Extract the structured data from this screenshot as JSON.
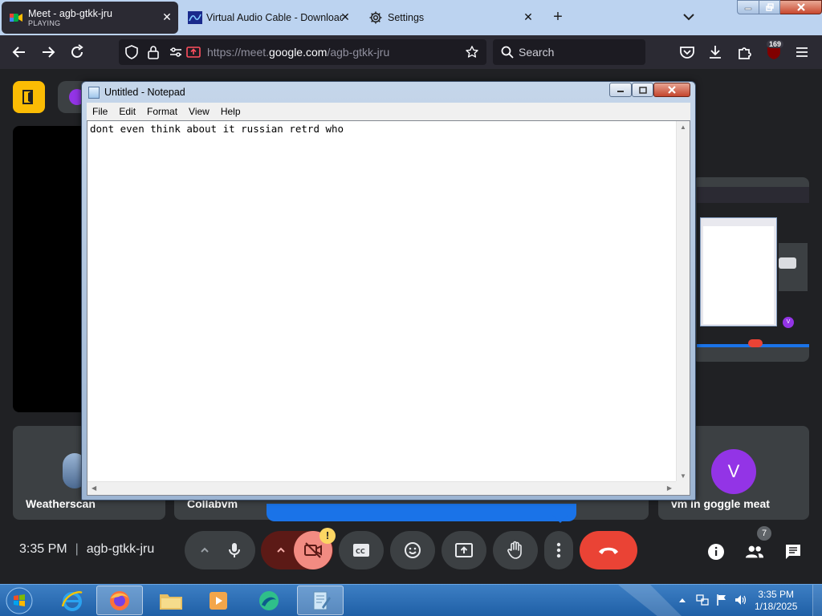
{
  "browser": {
    "tabs": [
      {
        "title": "Meet - agb-gtkk-jru",
        "status": "PLAYING",
        "active": true
      },
      {
        "title": "Virtual Audio Cable - Download",
        "active": false
      },
      {
        "title": "Settings",
        "active": false
      }
    ],
    "url_prefix": "https://meet.",
    "url_domain": "google.com",
    "url_path": "/agb-gtkk-jru",
    "search_placeholder": "Search",
    "extension_badge": "169"
  },
  "meet": {
    "time": "3:35 PM",
    "meeting_code": "agb-gtkk-jru",
    "participants_count": "7",
    "camera_warning": "!",
    "tiles": [
      {
        "name": "Weatherscan"
      },
      {
        "name": "Collabvm"
      },
      {
        "name": "vm in goggle meat",
        "avatar_letter": "V"
      }
    ],
    "share_avatar_letter": "V",
    "accent_color": "#9334e6",
    "hangup_color": "#ea4335"
  },
  "notepad": {
    "title": "Untitled - Notepad",
    "menus": [
      "File",
      "Edit",
      "Format",
      "View",
      "Help"
    ],
    "content": "dont even think about it russian retrd who"
  },
  "taskbar": {
    "clock_time": "3:35 PM",
    "clock_date": "1/18/2025"
  }
}
